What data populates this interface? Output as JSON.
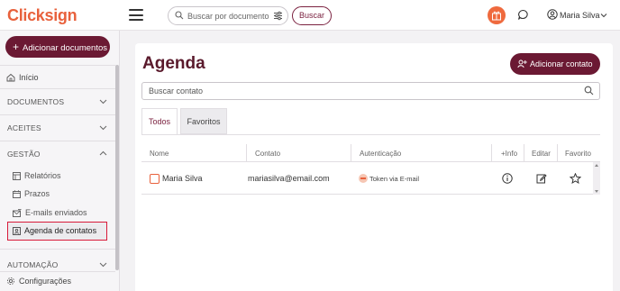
{
  "brand": {
    "logo": "Clicksign",
    "accent": "#6b1933",
    "orange": "#e8613c"
  },
  "topbar": {
    "search_placeholder": "Buscar por documento",
    "search_button": "Buscar",
    "user_name": "Maria Silva"
  },
  "sidebar": {
    "add_documents": "Adicionar documentos",
    "home": "Início",
    "sections": {
      "documentos": "DOCUMENTOS",
      "aceites": "ACEITES",
      "gestao": "GESTÃO",
      "automacao": "AUTOMAÇÃO"
    },
    "gestao_items": [
      "Relatórios",
      "Prazos",
      "E-mails enviados",
      "Agenda de contatos"
    ],
    "settings": "Configurações"
  },
  "main": {
    "title": "Agenda",
    "add_contact": "Adicionar contato",
    "search_placeholder": "Buscar contato",
    "tabs": [
      "Todos",
      "Favoritos"
    ],
    "columns": [
      "Nome",
      "Contato",
      "Autenticação",
      "+Info",
      "Editar",
      "Favorito"
    ],
    "rows": [
      {
        "name": "Maria Silva",
        "contact": "mariasilva@email.com",
        "auth": "Token via E-mail"
      }
    ]
  }
}
